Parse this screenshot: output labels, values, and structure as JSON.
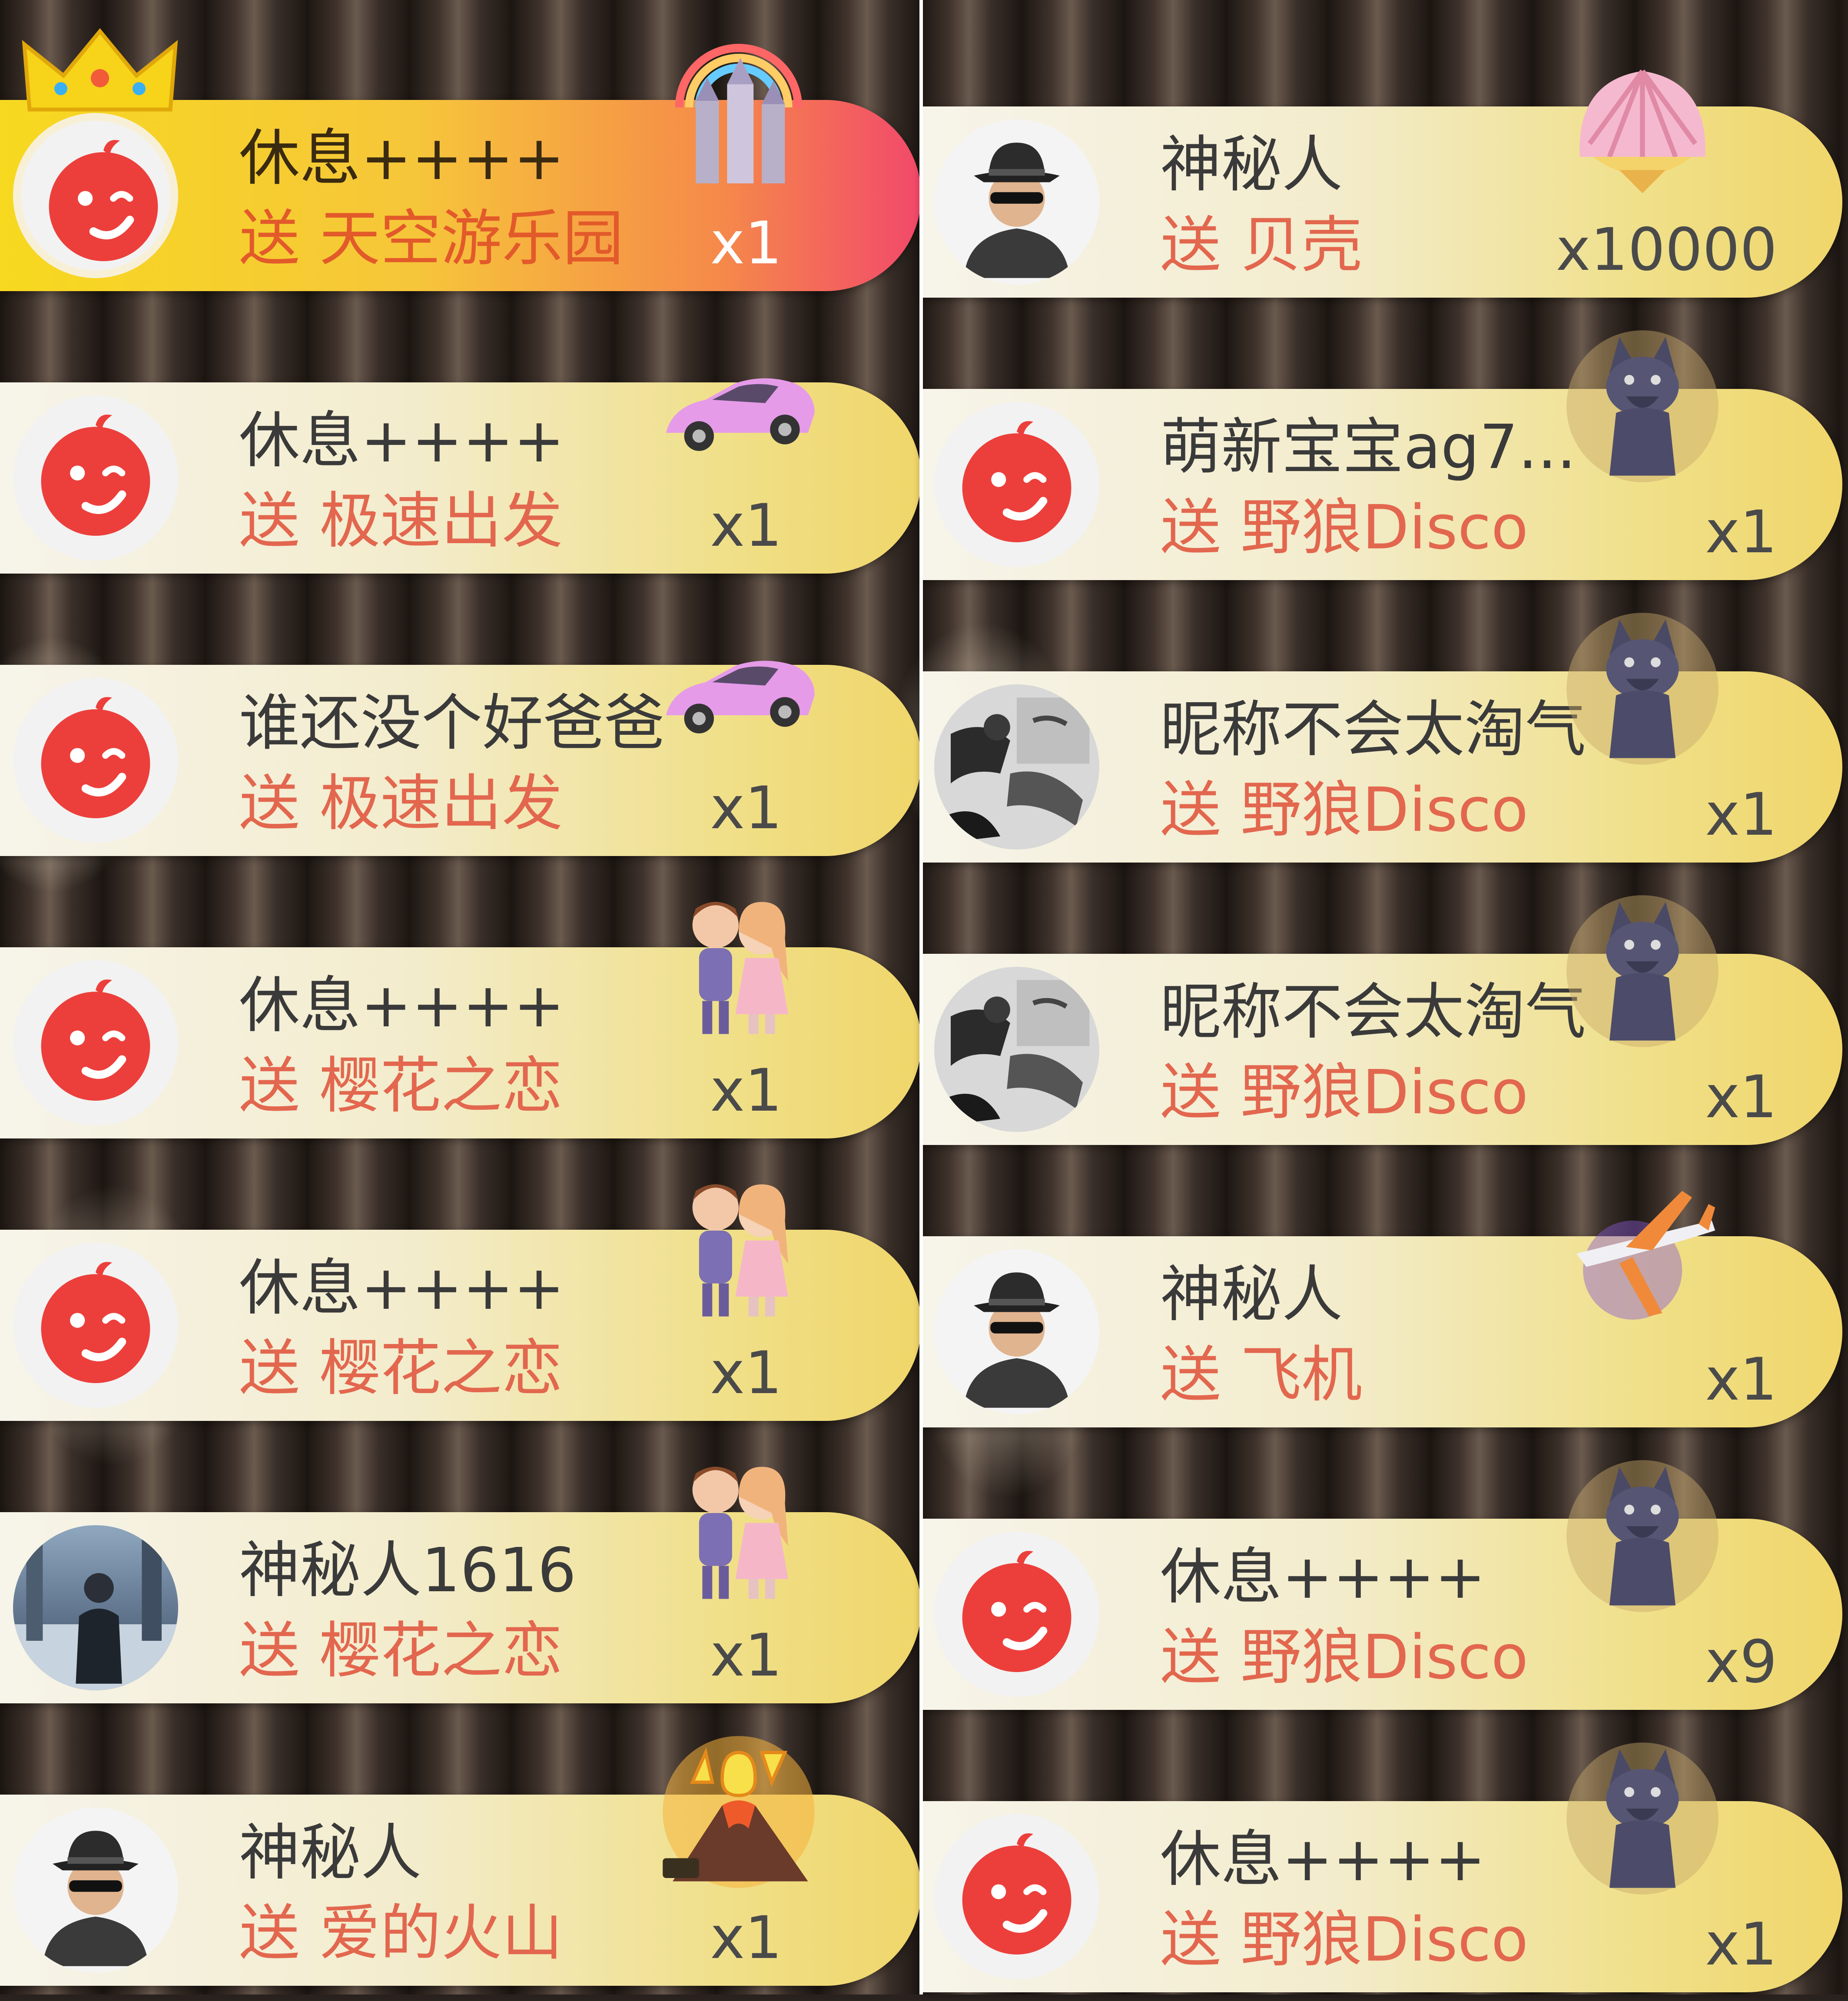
{
  "left_column": [
    {
      "name": "休息++++",
      "verb": "送",
      "gift": "天空游乐园",
      "count": "x1",
      "avatar": "red-face-avatar",
      "gift_icon": "rainbow-castle-icon",
      "highlight": true
    },
    {
      "name": "休息++++",
      "verb": "送",
      "gift": "极速出发",
      "count": "x1",
      "avatar": "red-face-avatar",
      "gift_icon": "pink-sports-car-icon"
    },
    {
      "name": "谁还没个好爸爸",
      "verb": "送",
      "gift": "极速出发",
      "count": "x1",
      "avatar": "red-face-avatar",
      "gift_icon": "pink-sports-car-icon"
    },
    {
      "name": "休息++++",
      "verb": "送",
      "gift": "樱花之恋",
      "count": "x1",
      "avatar": "red-face-avatar",
      "gift_icon": "couple-icon"
    },
    {
      "name": "休息++++",
      "verb": "送",
      "gift": "樱花之恋",
      "count": "x1",
      "avatar": "red-face-avatar",
      "gift_icon": "couple-icon"
    },
    {
      "name": "神秘人1616",
      "verb": "送",
      "gift": "樱花之恋",
      "count": "x1",
      "avatar": "photo-avatar",
      "gift_icon": "couple-icon"
    },
    {
      "name": "神秘人",
      "verb": "送",
      "gift": "爱的火山",
      "count": "x1",
      "avatar": "mystery-man-avatar",
      "gift_icon": "love-volcano-icon"
    }
  ],
  "right_column": [
    {
      "name": "神秘人",
      "verb": "送",
      "gift": "贝壳",
      "count": "x10000",
      "avatar": "mystery-man-avatar",
      "gift_icon": "shell-icon"
    },
    {
      "name": "萌新宝宝ag7...",
      "verb": "送",
      "gift": "野狼Disco",
      "count": "x1",
      "avatar": "red-face-avatar",
      "gift_icon": "wolf-icon"
    },
    {
      "name": "昵称不会太淘气",
      "verb": "送",
      "gift": "野狼Disco",
      "count": "x1",
      "avatar": "bw-photo-avatar",
      "gift_icon": "wolf-icon"
    },
    {
      "name": "昵称不会太淘气",
      "verb": "送",
      "gift": "野狼Disco",
      "count": "x1",
      "avatar": "bw-photo-avatar",
      "gift_icon": "wolf-icon"
    },
    {
      "name": "神秘人",
      "verb": "送",
      "gift": "飞机",
      "count": "x1",
      "avatar": "mystery-man-avatar",
      "gift_icon": "airplane-icon"
    },
    {
      "name": "休息++++",
      "verb": "送",
      "gift": "野狼Disco",
      "count": "x9",
      "avatar": "red-face-avatar",
      "gift_icon": "wolf-icon"
    },
    {
      "name": "休息++++",
      "verb": "送",
      "gift": "野狼Disco",
      "count": "x1",
      "avatar": "red-face-avatar",
      "gift_icon": "wolf-icon"
    }
  ],
  "colors": {
    "name_text": "#3a3a3a",
    "gift_text": "#e2674e",
    "count_text": "#4a4a4a",
    "face_red": "#ec3f3b"
  }
}
